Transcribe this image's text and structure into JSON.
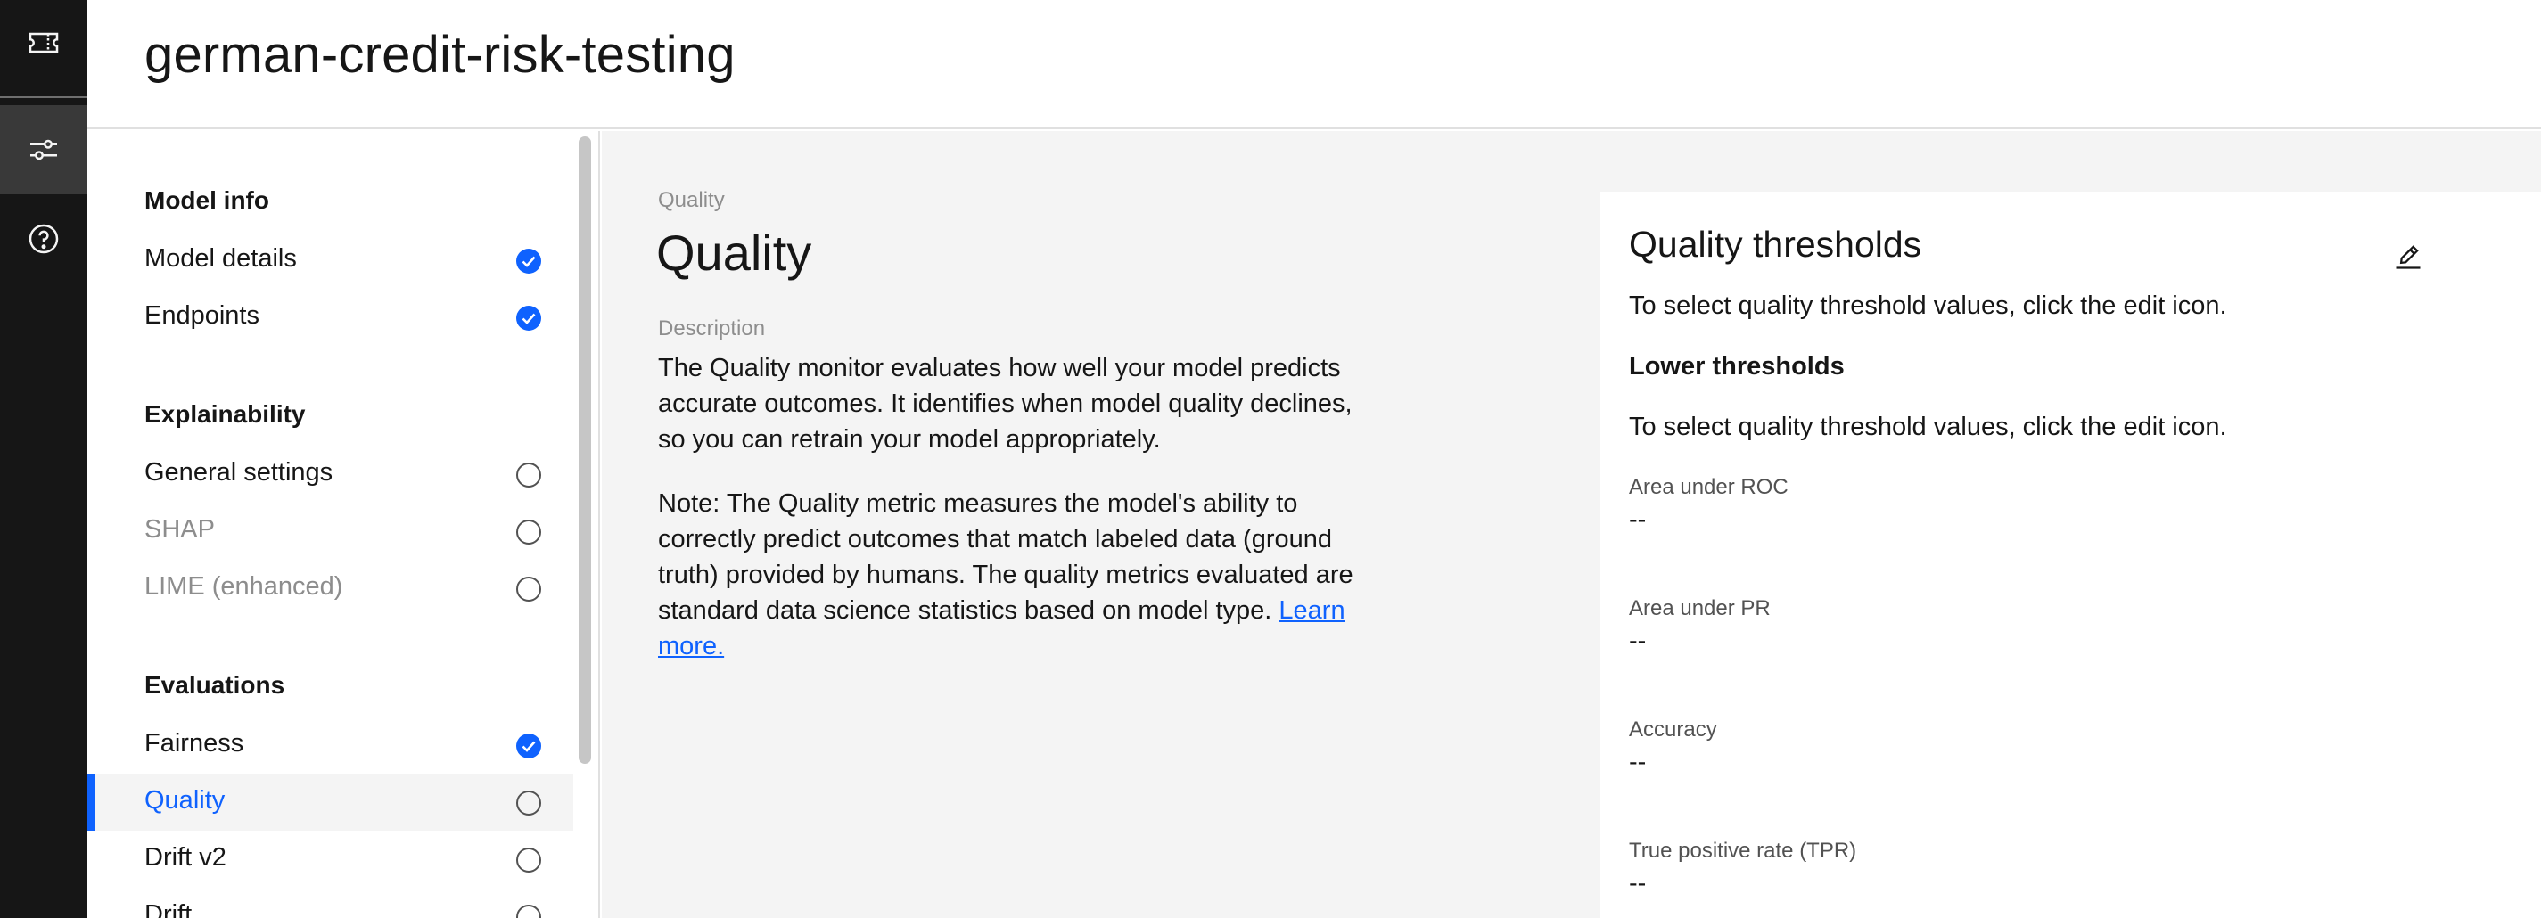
{
  "header": {
    "title": "german-credit-risk-testing"
  },
  "rail": {
    "items": [
      {
        "icon": "ticket-icon"
      },
      {
        "icon": "settings-adjust-icon"
      },
      {
        "icon": "help-icon"
      }
    ]
  },
  "nav": {
    "sections": [
      {
        "heading": "Model info",
        "items": [
          {
            "label": "Model details",
            "status": "complete"
          },
          {
            "label": "Endpoints",
            "status": "complete"
          }
        ]
      },
      {
        "heading": "Explainability",
        "items": [
          {
            "label": "General settings",
            "status": "incomplete"
          },
          {
            "label": "SHAP",
            "status": "incomplete",
            "disabled": true
          },
          {
            "label": "LIME (enhanced)",
            "status": "incomplete",
            "disabled": true
          }
        ]
      },
      {
        "heading": "Evaluations",
        "items": [
          {
            "label": "Fairness",
            "status": "complete"
          },
          {
            "label": "Quality",
            "status": "incomplete",
            "active": true
          },
          {
            "label": "Drift v2",
            "status": "incomplete"
          },
          {
            "label": "Drift",
            "status": "incomplete"
          }
        ]
      }
    ]
  },
  "main": {
    "eyebrow": "Quality",
    "title": "Quality",
    "description_label": "Description",
    "description": "The Quality monitor evaluates how well your model predicts accurate outcomes. It identifies when model quality declines, so you can retrain your model appropriately.",
    "note": "Note: The Quality metric measures the model's ability to correctly predict outcomes that match labeled data (ground truth) provided by humans. The quality metrics evaluated are standard data science statistics based on model type.",
    "learn_more": "Learn more."
  },
  "thresholds": {
    "title": "Quality thresholds",
    "intro": "To select quality threshold values, click the edit icon.",
    "lower_heading": "Lower thresholds",
    "lower_intro": "To select quality threshold values, click the edit icon.",
    "metrics": [
      {
        "label": "Area under ROC",
        "value": "--"
      },
      {
        "label": "Area under PR",
        "value": "--"
      },
      {
        "label": "Accuracy",
        "value": "--"
      },
      {
        "label": "True positive rate (TPR)",
        "value": "--"
      }
    ]
  },
  "colors": {
    "accent": "#0f62fe",
    "rail_bg": "#161616",
    "main_bg": "#f4f4f4"
  }
}
